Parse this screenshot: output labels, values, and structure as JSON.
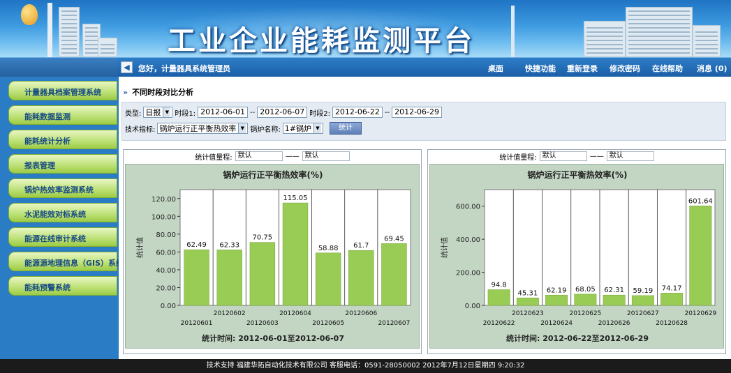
{
  "header": {
    "title": "工业企业能耗监测平台"
  },
  "nav": {
    "greeting": "您好，计量器具系统管理员",
    "items": [
      "桌面",
      "快捷功能",
      "重新登录",
      "修改密码",
      "在线帮助",
      "消息 (0)"
    ]
  },
  "sidebar": {
    "items": [
      "计量器具档案管理系统",
      "能耗数据监测",
      "能耗统计分析",
      "报表管理",
      "锅炉热效率监测系统",
      "水泥能效对标系统",
      "能源在线审计系统",
      "能源源地理信息（GIS）系统",
      "能耗预警系统"
    ]
  },
  "section": {
    "title": "不同时段对比分析"
  },
  "filter": {
    "type_label": "类型:",
    "type_value": "日报",
    "period1_label": "时段1:",
    "period1_start": "2012-06-01",
    "period1_end": "2012-06-07",
    "period2_label": "时段2:",
    "period2_start": "2012-06-22",
    "period2_end": "2012-06-29",
    "sep": "--",
    "indicator_label": "技术指标:",
    "indicator_value": "锅炉运行正平衡热效率",
    "boiler_label": "锅炉名称:",
    "boiler_value": "1#锅炉",
    "submit_label": "统计"
  },
  "panels": [
    {
      "range_label": "统计值量程:",
      "min": "默认",
      "dash": "——",
      "max": "默认",
      "time_label": "统计时间: 2012-06-01至2012-06-07"
    },
    {
      "range_label": "统计值量程:",
      "min": "默认",
      "dash": "——",
      "max": "默认",
      "time_label": "统计时间: 2012-06-22至2012-06-29"
    }
  ],
  "chart_data": [
    {
      "type": "bar",
      "title": "锅炉运行正平衡热效率(%)",
      "ylabel": "统计值",
      "categories": [
        "20120601",
        "20120602",
        "20120603",
        "20120604",
        "20120605",
        "20120606",
        "20120607"
      ],
      "values": [
        62.49,
        62.33,
        70.75,
        115.05,
        58.88,
        61.7,
        69.45
      ],
      "value_labels": [
        "62.49",
        "62.33",
        "70.75",
        "115.05",
        "58.88",
        "61.7",
        "69.45"
      ],
      "yticks": [
        "0.00",
        "20.00",
        "40.00",
        "60.00",
        "80.00",
        "100.00",
        "120.00"
      ],
      "ylim": [
        0,
        130
      ],
      "grid": true,
      "color": "#99cc55"
    },
    {
      "type": "bar",
      "title": "锅炉运行正平衡热效率(%)",
      "ylabel": "统计值",
      "categories": [
        "20120622",
        "20120623",
        "20120624",
        "20120625",
        "20120626",
        "20120627",
        "20120628",
        "20120629"
      ],
      "values": [
        94.8,
        45.31,
        62.19,
        68.05,
        62.31,
        59.19,
        74.17,
        601.64
      ],
      "value_labels": [
        "94.8",
        "45.31",
        "62.19",
        "68.05",
        "62.31",
        "59.19",
        "74.17",
        "601.64"
      ],
      "yticks": [
        "0.00",
        "200.00",
        "400.00",
        "600.00"
      ],
      "ylim": [
        0,
        700
      ],
      "grid": true,
      "color": "#99cc55"
    }
  ],
  "footer": {
    "text": "技术支持 福建华拓自动化技术有限公司 客服电话：0591-28050002 2012年7月12日星期四 9:20:32"
  }
}
